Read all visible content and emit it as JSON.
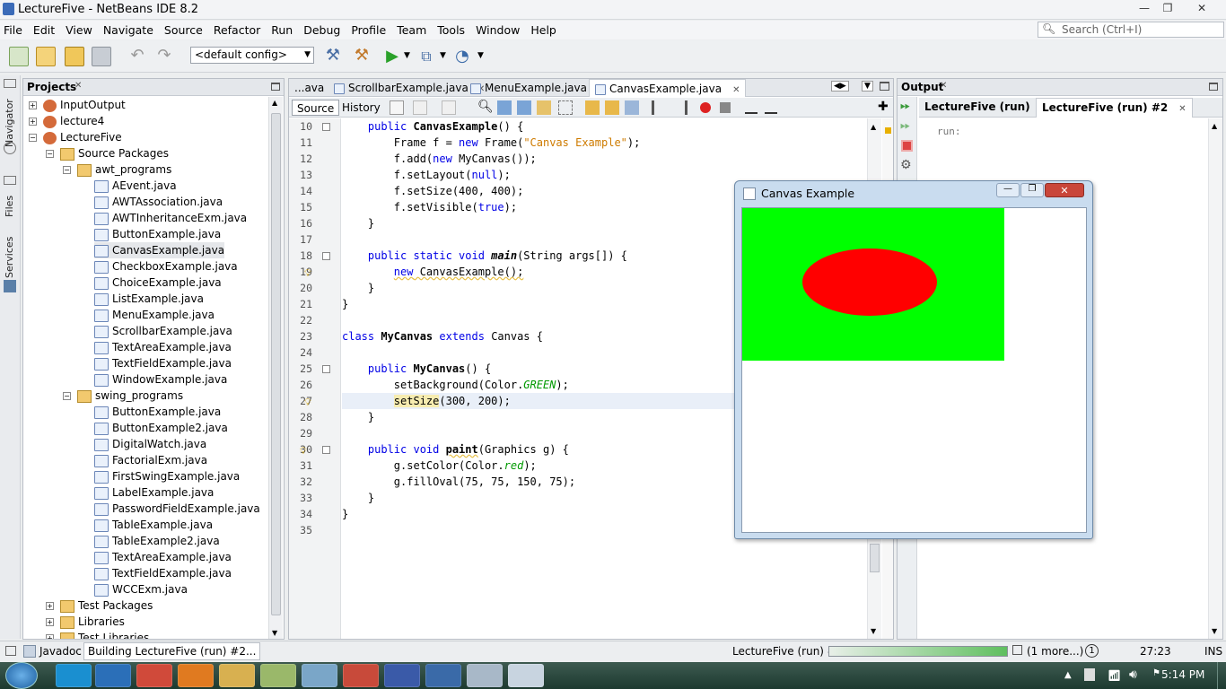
{
  "window": {
    "title": "LectureFive - NetBeans IDE 8.2"
  },
  "menu": [
    "File",
    "Edit",
    "View",
    "Navigate",
    "Source",
    "Refactor",
    "Run",
    "Debug",
    "Profile",
    "Team",
    "Tools",
    "Window",
    "Help"
  ],
  "search": {
    "placeholder": "Search (Ctrl+I)"
  },
  "toolbar": {
    "config": "<default config>"
  },
  "leftstrip": {
    "navigator": "Navigator",
    "files": "Files",
    "services": "Services"
  },
  "projects": {
    "title": "Projects",
    "nodes": [
      "InputOutput",
      "lecture4",
      "LectureFive",
      "Source Packages",
      "awt_programs",
      "AEvent.java",
      "AWTAssociation.java",
      "AWTInheritanceExm.java",
      "ButtonExample.java",
      "CanvasExample.java",
      "CheckboxExample.java",
      "ChoiceExample.java",
      "ListExample.java",
      "MenuExample.java",
      "ScrollbarExample.java",
      "TextAreaExample.java",
      "TextFieldExample.java",
      "WindowExample.java",
      "swing_programs",
      "ButtonExample.java",
      "ButtonExample2.java",
      "DigitalWatch.java",
      "FactorialExm.java",
      "FirstSwingExample.java",
      "LabelExample.java",
      "PasswordFieldExample.java",
      "TableExample.java",
      "TableExample2.java",
      "TextAreaExample.java",
      "TextFieldExample.java",
      "WCCExm.java",
      "Test Packages",
      "Libraries",
      "Test Libraries"
    ]
  },
  "editor": {
    "tabs": [
      "...ava",
      "ScrollbarExample.java",
      "MenuExample.java",
      "CanvasExample.java"
    ],
    "source": "Source",
    "history": "History",
    "lines": [
      "10",
      "11",
      "12",
      "13",
      "14",
      "15",
      "16",
      "17",
      "18",
      "19",
      "20",
      "21",
      "22",
      "23",
      "24",
      "25",
      "26",
      "27",
      "28",
      "29",
      "30",
      "31",
      "32",
      "33",
      "34",
      "35"
    ]
  },
  "code": {
    "l10a": "    public ",
    "l10b": "CanvasExample",
    "l10c": "() {",
    "l11a": "        Frame f = ",
    "l11b": "new",
    "l11c": " Frame(",
    "l11d": "\"Canvas Example\"",
    "l11e": ");",
    "l12a": "        f.add(",
    "l12b": "new",
    "l12c": " MyCanvas());",
    "l13a": "        f.setLayout(",
    "l13b": "null",
    "l13c": ");",
    "l14": "        f.setSize(400, 400);",
    "l15a": "        f.setVisible(",
    "l15b": "true",
    "l15c": ");",
    "l16": "    }",
    "l18a": "    public static void ",
    "l18b": "main",
    "l18c": "(String args[]) {",
    "l19a": "        ",
    "l19b": "new",
    "l19c": " CanvasExample();",
    "l20": "    }",
    "l21": "}",
    "l23a": "class ",
    "l23b": "MyCanvas",
    "l23c": " extends ",
    "l23d": "Canvas {",
    "l25a": "    public ",
    "l25b": "MyCanvas",
    "l25c": "() {",
    "l26a": "        setBackground(Color.",
    "l26b": "GREEN",
    "l26c": ");",
    "l27a": "        ",
    "l27b": "setSize",
    "l27c": "(300, 200);",
    "l28": "    }",
    "l30a": "    public void ",
    "l30b": "paint",
    "l30c": "(Graphics g) {",
    "l31a": "        g.setColor(Color.",
    "l31b": "red",
    "l31c": ");",
    "l32": "        g.fillOval(75, 75, 150, 75);",
    "l33": "    }",
    "l34": "}"
  },
  "canvaswindow": {
    "title": "Canvas Example",
    "canvas_bg": "#00ff00",
    "oval_color": "#ff0000"
  },
  "output": {
    "title": "Output",
    "tab1": "LectureFive (run)",
    "tab2": "LectureFive (run) #2",
    "run": "run:"
  },
  "status": {
    "javadoc": "Javadoc",
    "building": "Building LectureFive (run) #2...",
    "task": "LectureFive (run) #2",
    "more": "(1 more...)",
    "badge": "1",
    "pos": "27:23",
    "mode": "INS"
  },
  "taskbar": {
    "time": "5:14 PM"
  }
}
